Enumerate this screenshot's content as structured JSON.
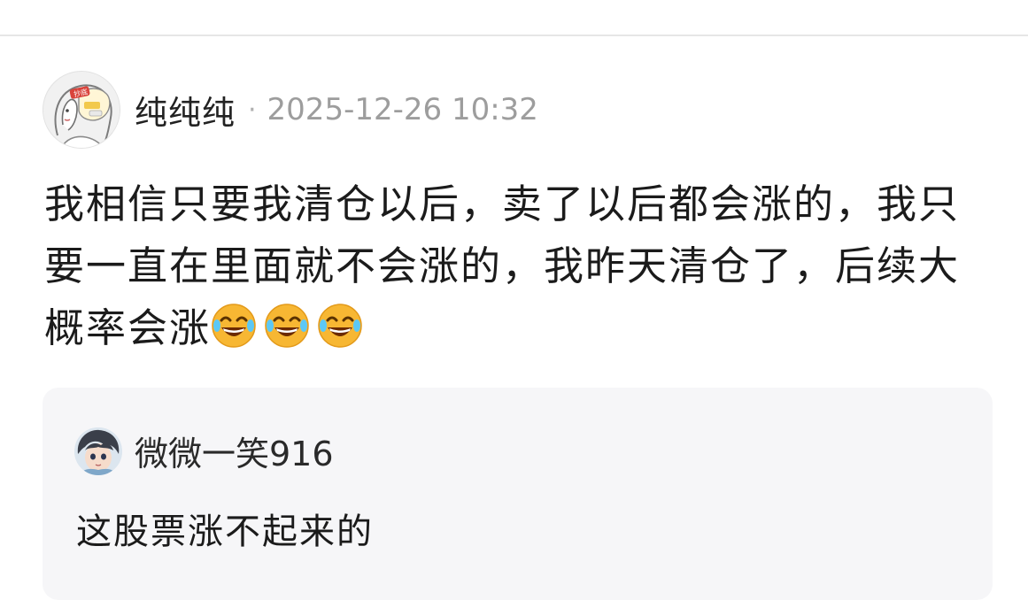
{
  "post": {
    "author": {
      "name": "纯纯纯",
      "avatar_icon": "cartoon-girl-avatar",
      "badge_text": "抄底"
    },
    "meta_separator": "·",
    "timestamp": "2025-12-26 10:32",
    "body": "我相信只要我清仓以后，卖了以后都会涨的，我只要一直在里面就不会涨的，我昨天清仓了，后续大概率会涨",
    "emojis": [
      "laughing-tears-emoji",
      "laughing-tears-emoji",
      "laughing-tears-emoji"
    ]
  },
  "quoted": {
    "author": {
      "name": "微微一笑916",
      "avatar_icon": "anime-boy-avatar"
    },
    "text": "这股票涨不起来的"
  },
  "colors": {
    "divider": "#e6e6e6",
    "card_bg": "#f6f6f8",
    "meta_gray": "#9d9d9d",
    "emoji_yellow": "#f7b733",
    "badge_red": "#d9433b"
  }
}
